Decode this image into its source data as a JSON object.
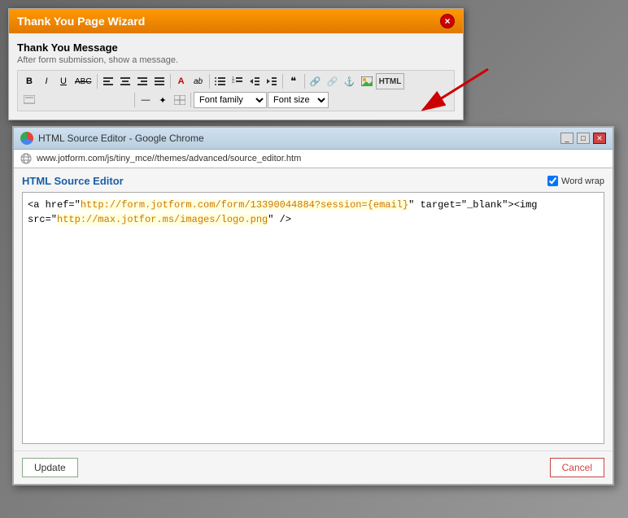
{
  "wizard": {
    "title": "Thank You Page Wizard",
    "close_label": "×",
    "section_title": "Thank You Message",
    "section_desc": "After form submission, show a message.",
    "toolbar": {
      "row1": {
        "bold": "B",
        "italic": "I",
        "underline": "U",
        "strikethrough": "ABC",
        "align_left": "≡",
        "align_center": "≡",
        "align_right": "≡",
        "align_justify": "≡",
        "text_color": "A",
        "highlight": "ab",
        "bullet_list": "≔",
        "numbered_list": "≔",
        "decrease_indent": "⇤",
        "increase_indent": "⇥",
        "blockquote": "❝",
        "link": "🔗",
        "unlink": "🔗",
        "anchor": "⚓",
        "image": "🖼",
        "html": "HTML"
      },
      "row2": {
        "edit": "✎",
        "btn1": "",
        "font_family": "Font family",
        "font_size": "Font size"
      }
    }
  },
  "source_editor": {
    "window_title": "HTML Source Editor - Google Chrome",
    "url": "www.jotform.com/js/tiny_mce//themes/advanced/source_editor.htm",
    "heading": "HTML Source Editor",
    "word_wrap_label": "Word wrap",
    "code_line1_prefix": "<a href=\"",
    "code_line1_url": "http://form.jotform.com/form/13390044884?session={email}",
    "code_line1_suffix": "\" target=\"_blank\"><img",
    "code_line2_prefix": "src=\"",
    "code_line2_url": "http://max.jotfor.ms/images/logo.png",
    "code_line2_suffix": "\" />",
    "update_label": "Update",
    "cancel_label": "Cancel"
  },
  "arrow": {
    "color": "#cc0000"
  }
}
